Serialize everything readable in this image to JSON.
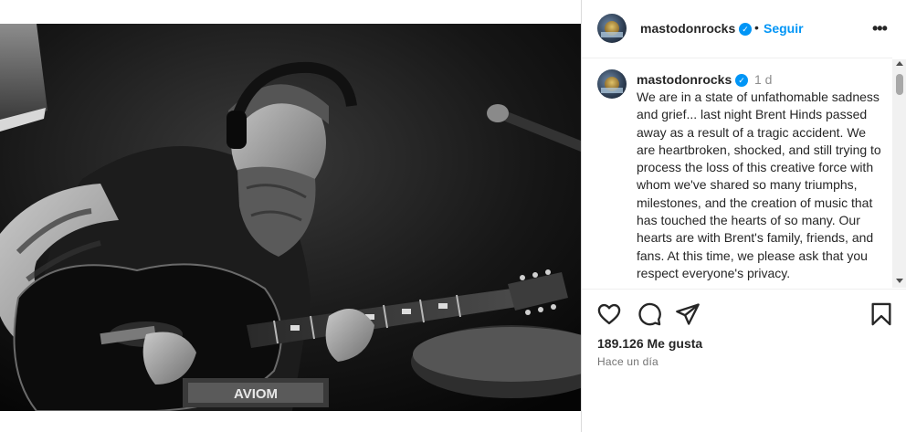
{
  "post": {
    "username": "mastodonrocks",
    "verified_glyph": "✓",
    "dot": "•",
    "follow_label": "Seguir",
    "more_glyph": "•••",
    "caption_time": "1 d",
    "caption": "We are in a state of unfathomable sadness and grief... last night Brent Hinds passed away as a result of a tragic accident. We are heartbroken, shocked, and still trying to process the loss of this creative force with whom we've shared so many triumphs, milestones, and the creation of music that has touched the hearts of so many. Our hearts are with Brent's family, friends, and fans. At this time, we please ask that you respect everyone's privacy.",
    "likes": "189.126 Me gusta",
    "posted": "Hace un día"
  },
  "media": {
    "brand_text": "AVIOM"
  },
  "icons": {
    "like": "heart-icon",
    "comment": "comment-bubble-icon",
    "share": "paper-plane-icon",
    "save": "bookmark-icon",
    "more": "more-options-icon",
    "verified": "verified-badge-icon"
  },
  "colors": {
    "link": "#0095f6",
    "text": "#262626",
    "muted": "#737373",
    "verified": "#0095f6"
  }
}
